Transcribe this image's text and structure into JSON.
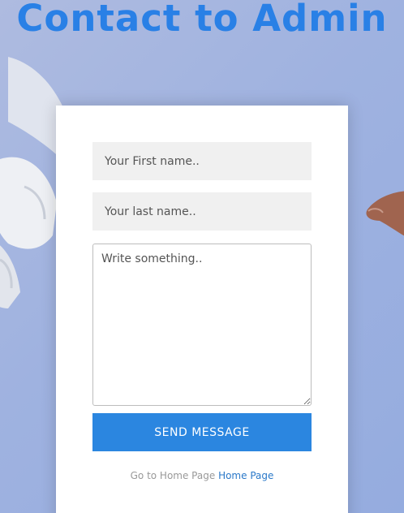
{
  "header": {
    "title": "Contact to Admin"
  },
  "form": {
    "first_name_placeholder": "Your First name..",
    "last_name_placeholder": "Your last name..",
    "message_placeholder": "Write something..",
    "send_label": "SEND MESSAGE"
  },
  "footer": {
    "prompt": "Go to Home Page",
    "link_label": "Home Page"
  },
  "colors": {
    "accent": "#2b86e0",
    "title": "#2980e6",
    "background": "#9fb2e0"
  }
}
